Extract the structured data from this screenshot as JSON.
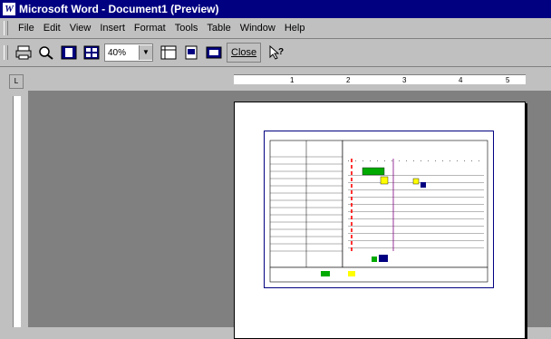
{
  "window": {
    "title": "Microsoft Word - Document1 (Preview)"
  },
  "menubar": {
    "items": [
      "File",
      "Edit",
      "View",
      "Insert",
      "Format",
      "Tools",
      "Table",
      "Window",
      "Help"
    ]
  },
  "toolbar": {
    "zoom_value": "40%",
    "close_label": "Close"
  },
  "ruler": {
    "numbers": [
      "1",
      "2",
      "3",
      "4",
      "5"
    ]
  }
}
